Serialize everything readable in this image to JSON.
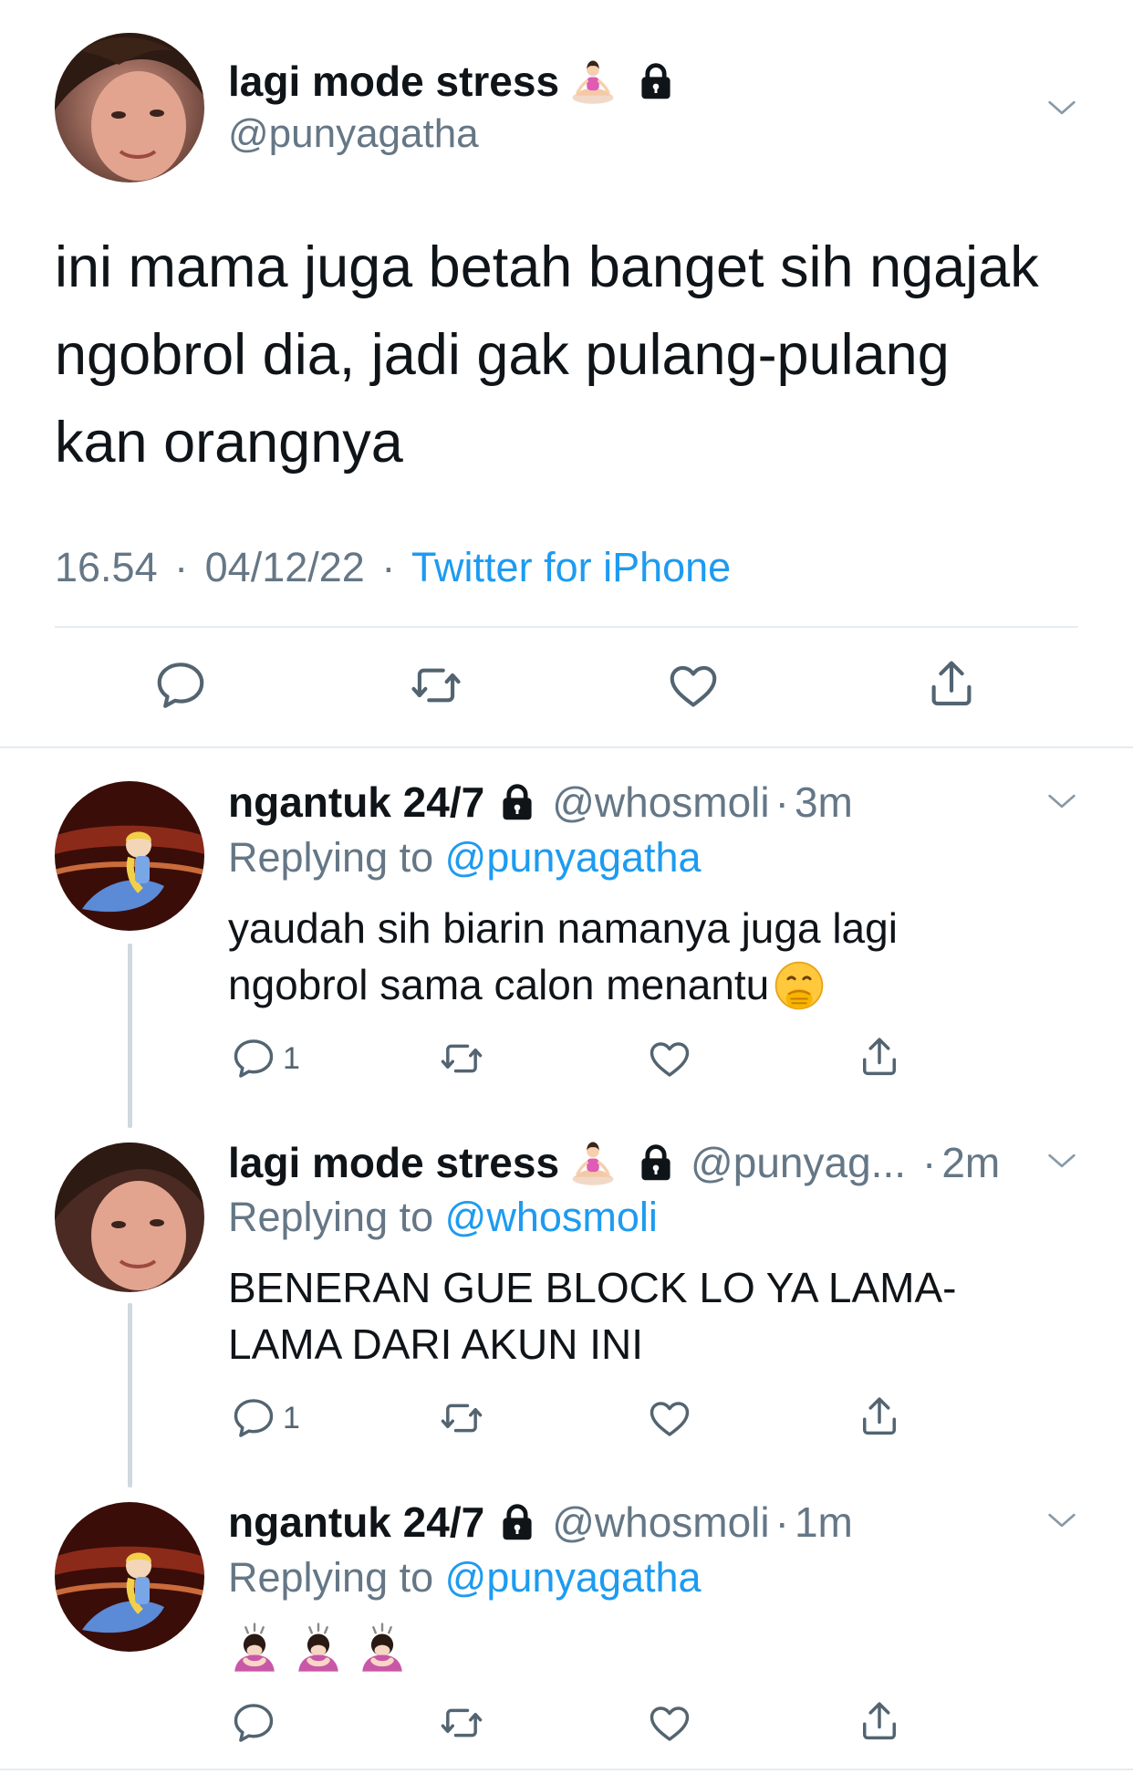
{
  "main_tweet": {
    "display_name": "lagi mode stress",
    "handle": "@punyagatha",
    "text_lines": [
      "ini mama juga betah banget sih ngajak",
      "ngobrol dia, jadi gak pulang-pulang",
      "kan orangnya"
    ],
    "time": "16.54",
    "date": "04/12/22",
    "source": "Twitter for iPhone",
    "separator": "·"
  },
  "replies": [
    {
      "display_name": "ngantuk 24/7",
      "handle": "@whosmoli",
      "time_ago": "3m",
      "replying_label": "Replying to",
      "replying_to": "@punyagatha",
      "text_lines": [
        "yaudah sih biarin namanya juga lagi",
        "ngobrol sama calon menantu"
      ],
      "reply_count": "1"
    },
    {
      "display_name": "lagi mode stress",
      "handle": "@punyag...",
      "time_ago": "2m",
      "replying_label": "Replying to",
      "replying_to": "@whosmoli",
      "text_lines": [
        "BENERAN GUE BLOCK LO YA LAMA-",
        "LAMA DARI AKUN INI"
      ],
      "reply_count": "1"
    },
    {
      "display_name": "ngantuk 24/7",
      "handle": "@whosmoli",
      "time_ago": "1m",
      "replying_label": "Replying to",
      "replying_to": "@punyagatha",
      "text_lines": [],
      "reply_count": ""
    }
  ],
  "colors": {
    "link_blue": "#1d9bf0",
    "meta_grey": "#657786",
    "icon_grey": "#536471",
    "thread_line": "#cfd9de"
  },
  "icons": [
    "chevron-down-icon",
    "lock-icon",
    "yoga-emoji",
    "shush-emoji",
    "bowing-emoji",
    "reply-icon",
    "retweet-icon",
    "like-icon",
    "share-icon"
  ]
}
